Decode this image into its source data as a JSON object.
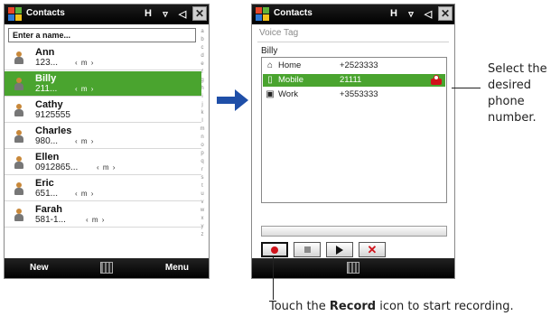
{
  "left_screen": {
    "title": "Contacts",
    "search_placeholder": "Enter a name...",
    "alphabet": [
      "a",
      "b",
      "c",
      "d",
      "e",
      "f",
      "g",
      "h",
      "i",
      "j",
      "k",
      "l",
      "m",
      "n",
      "o",
      "p",
      "q",
      "r",
      "s",
      "t",
      "u",
      "v",
      "w",
      "x",
      "y",
      "z"
    ],
    "contacts": [
      {
        "name": "Ann",
        "sub": "123...",
        "ctrl": "‹ m ›",
        "selected": false
      },
      {
        "name": "Billy",
        "sub": "211...",
        "ctrl": "‹ m ›",
        "selected": true
      },
      {
        "name": "Cathy",
        "sub": "9125555",
        "ctrl": "",
        "selected": false
      },
      {
        "name": "Charles",
        "sub": "980...",
        "ctrl": "‹ m ›",
        "selected": false
      },
      {
        "name": "Ellen",
        "sub": "0912865...",
        "ctrl": "‹ m ›",
        "selected": false
      },
      {
        "name": "Eric",
        "sub": "651...",
        "ctrl": "‹ m ›",
        "selected": false
      },
      {
        "name": "Farah",
        "sub": "581-1...",
        "ctrl": "‹ m ›",
        "selected": false
      }
    ],
    "softkey_left": "New",
    "softkey_right": "Menu"
  },
  "right_screen": {
    "title": "Contacts",
    "header": "Voice Tag",
    "contact_name": "Billy",
    "numbers": [
      {
        "type": "Home",
        "number": "+2523333",
        "icon": "home-icon",
        "selected": false
      },
      {
        "type": "Mobile",
        "number": "21111",
        "icon": "mobile-icon",
        "selected": true
      },
      {
        "type": "Work",
        "number": "+3553333",
        "icon": "work-icon",
        "selected": false
      }
    ],
    "buttons": [
      "record-button",
      "stop-button",
      "play-button",
      "delete-button"
    ]
  },
  "callouts": {
    "select_text": [
      "Select the",
      "desired",
      "phone",
      "number."
    ],
    "record_prefix": "Touch the ",
    "record_bold": "Record",
    "record_suffix": " icon to start recording."
  },
  "colors": {
    "selection_green": "#4aa42f",
    "arrow_blue": "#1f4fa8",
    "record_red": "#d0121b"
  }
}
